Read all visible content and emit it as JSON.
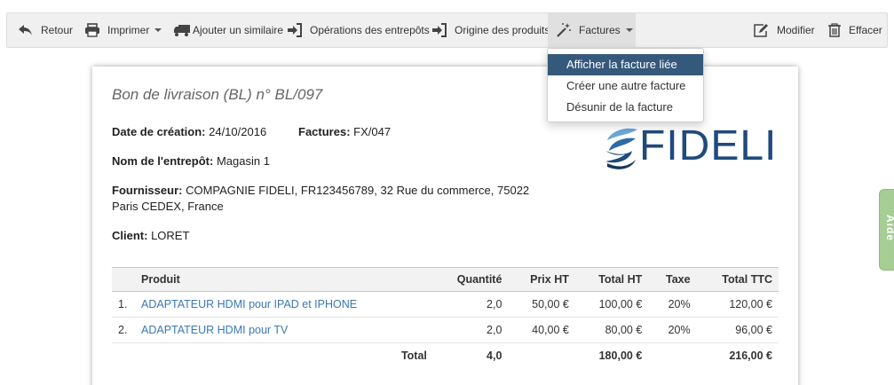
{
  "toolbar": {
    "back": "Retour",
    "print": "Imprimer",
    "add_similar": "Ajouter un similaire",
    "warehouse_ops": "Opérations des entrepôts",
    "product_origin": "Origine des produits",
    "invoices": "Factures",
    "edit": "Modifier",
    "delete": "Effacer"
  },
  "invoice_menu": {
    "items": [
      "Afficher la facture liée",
      "Créer une autre facture",
      "Désunir de la facture"
    ]
  },
  "document": {
    "title": "Bon de livraison (BL) n° BL/097",
    "creation_label": "Date de création:",
    "creation_date": "24/10/2016",
    "invoices_label": "Factures:",
    "invoices_value": "FX/047",
    "warehouse_label": "Nom de l'entrepôt:",
    "warehouse_value": "Magasin 1",
    "supplier_label": "Fournisseur:",
    "supplier_line1": "COMPAGNIE FIDELI, FR123456789, 32 Rue du commerce, 75022",
    "supplier_line2": "Paris CEDEX, France",
    "client_label": "Client:",
    "client_value": "LORET",
    "logo_text": "FIDELI"
  },
  "table": {
    "headers": [
      "Produit",
      "Quantité",
      "Prix HT",
      "Total HT",
      "Taxe",
      "Total TTC"
    ],
    "rows": [
      {
        "num": "1.",
        "product": "ADAPTATEUR HDMI pour IPAD et IPHONE",
        "qty": "2,0",
        "price": "50,00 €",
        "total_ht": "100,00 €",
        "tax": "20%",
        "total_ttc": "120,00 €"
      },
      {
        "num": "2.",
        "product": "ADAPTATEUR HDMI pour TV",
        "qty": "2,0",
        "price": "40,00 €",
        "total_ht": "80,00 €",
        "tax": "20%",
        "total_ttc": "96,00 €"
      }
    ],
    "total": {
      "label": "Total",
      "qty": "4,0",
      "total_ht": "180,00 €",
      "total_ttc": "216,00 €"
    }
  },
  "help_tab": "Aide",
  "colors": {
    "accent": "#34597b",
    "link": "#3a78b6",
    "logo": "#1f4a7d",
    "help": "#a5cd94"
  }
}
